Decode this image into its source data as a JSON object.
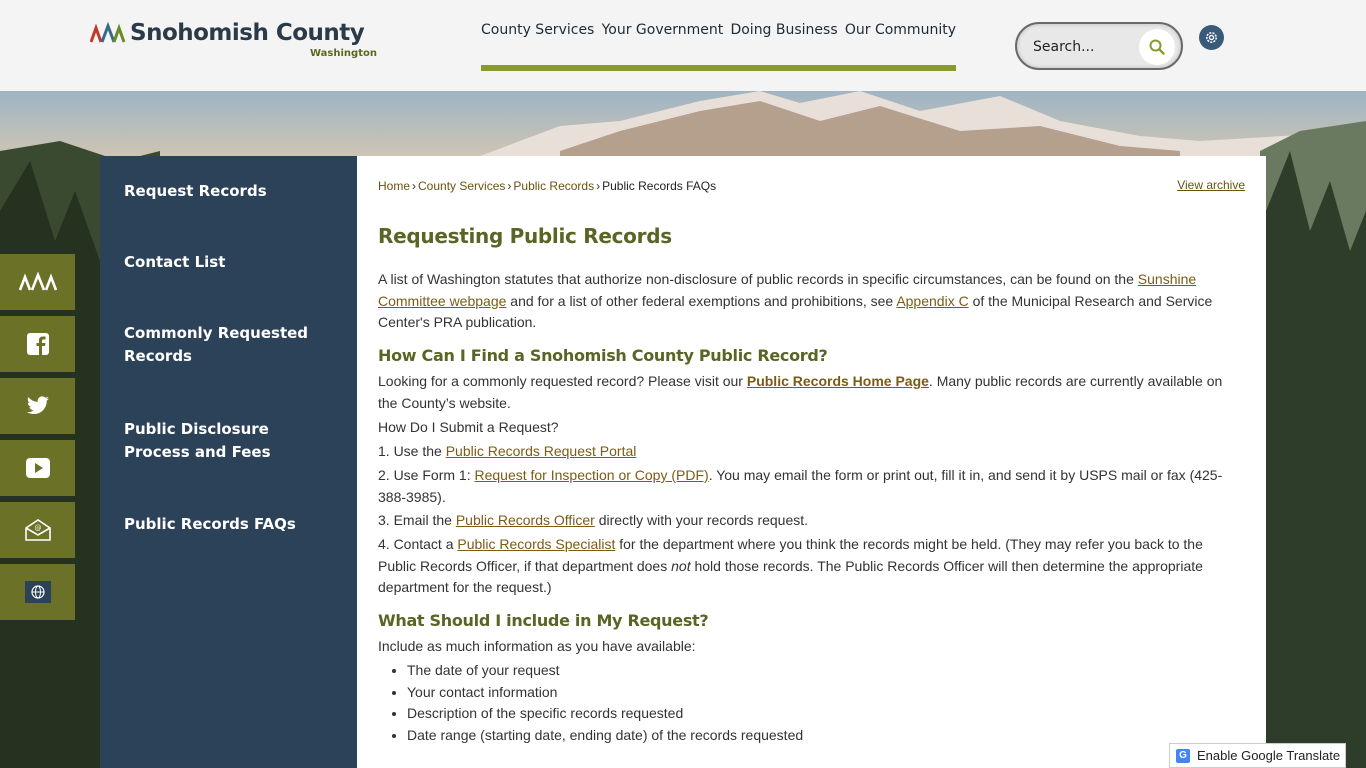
{
  "header": {
    "logo_text": "Snohomish County",
    "logo_sub": "Washington",
    "nav": [
      "County Services",
      "Your Government",
      "Doing Business",
      "Our Community"
    ],
    "search_placeholder": "Search..."
  },
  "social": [
    "county-logo-icon",
    "facebook-icon",
    "twitter-icon",
    "youtube-icon",
    "email-icon",
    "translate-globe-icon"
  ],
  "sidebar": {
    "items": [
      "Request Records",
      "Contact List",
      "Commonly Requested Records",
      "Public Disclosure Process and Fees",
      "Public Records FAQs"
    ]
  },
  "breadcrumb": {
    "home": "Home",
    "county_services": "County Services",
    "public_records": "Public Records",
    "current": "Public Records FAQs"
  },
  "view_archive": "View archive",
  "content": {
    "title": "Requesting Public Records",
    "intro_1": "A list of Washington statutes that authorize non-disclosure of public records in specific circumstances, can be found on the ",
    "intro_link_1": "Sunshine Committee webpage",
    "intro_2": " and for a list of other federal exemptions and prohibitions, see ",
    "intro_link_2": "Appendix C",
    "intro_3": " of the Municipal Research and Service Center's PRA publication.",
    "h_find": "How Can I Find a Snohomish County Public Record?",
    "find_1": "Looking for a commonly requested record? Please visit our ",
    "find_link": "Public Records Home Page",
    "find_2": ". Many public records are currently available on the County’s website.",
    "submit_q": "How Do I Submit a Request?",
    "step1_pre": "1. Use the ",
    "step1_link": "Public Records Request Portal",
    "step2_pre": "2. Use Form 1: ",
    "step2_link": "Request for Inspection or Copy (PDF)",
    "step2_post": ". You may email the form or print out, fill it in, and send it by USPS mail or fax (425-388-3985).",
    "step3_pre": "3. Email the ",
    "step3_link": "Public Records Officer",
    "step3_post": " directly with your records request.",
    "step4_pre": "4. Contact a ",
    "step4_link": "Public Records Specialist",
    "step4_mid": " for the department where you think the records might be held. (They may refer you back to the Public Records Officer, if that department does ",
    "step4_em": "not",
    "step4_post": " hold those records. The Public Records Officer will then determine the appropriate department for the request.)",
    "h_include": "What Should I include in My Request?",
    "include_intro": "Include as much information as you have available:",
    "include_items": [
      "The date of your request",
      "Your contact information",
      "Description of the specific records requested",
      "Date range (starting date, ending date) of the records requested"
    ]
  },
  "translate_label": "Enable Google Translate",
  "colors": {
    "sidebar": "#2c4258",
    "accent_olive": "#6b7227",
    "heading": "#5a6424",
    "link": "#7a5c14"
  }
}
